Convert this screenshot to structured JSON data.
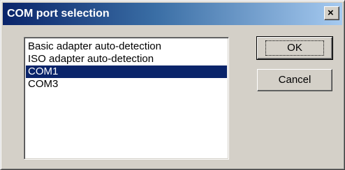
{
  "window": {
    "title": "COM port selection",
    "close_glyph": "×"
  },
  "list": {
    "items": [
      {
        "label": "Basic adapter auto-detection",
        "selected": false
      },
      {
        "label": "ISO adapter auto-detection",
        "selected": false
      },
      {
        "label": "COM1",
        "selected": true
      },
      {
        "label": "COM3",
        "selected": false
      }
    ]
  },
  "buttons": {
    "ok_label": "OK",
    "cancel_label": "Cancel"
  },
  "colors": {
    "selection": "#0a246a",
    "title_gradient_start": "#0a246a",
    "title_gradient_end": "#a6caf0",
    "face": "#d4d0c8"
  }
}
